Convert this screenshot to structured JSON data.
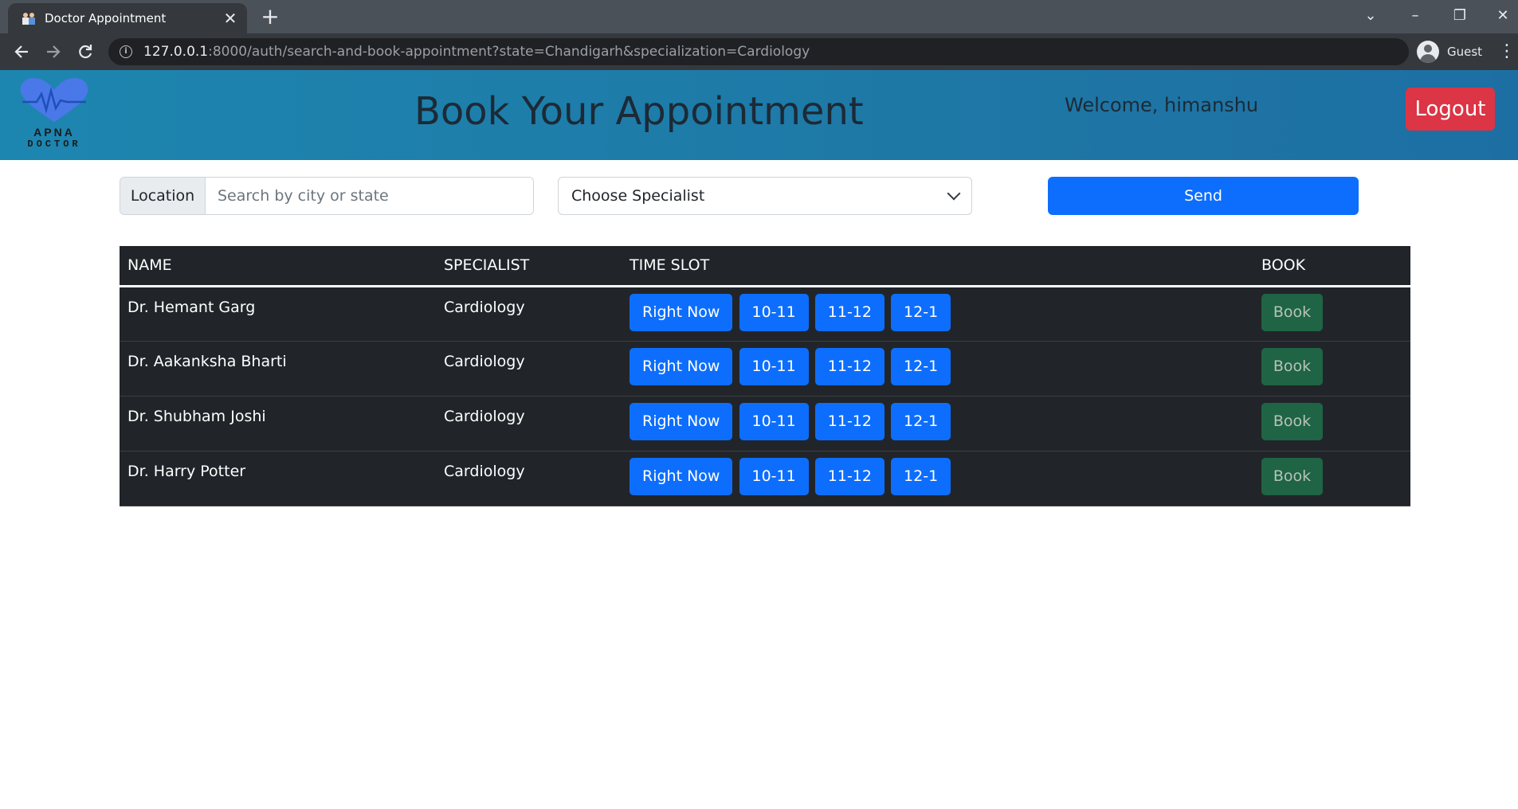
{
  "browser": {
    "tab_title": "Doctor Appointment",
    "tab_close": "✕",
    "new_tab": "+",
    "url_host": "127.0.0.1",
    "url_rest": ":8000/auth/search-and-book-appointment?state=Chandigarh&specialization=Cardiology",
    "profile_label": "Guest",
    "icons": [
      "back-arrow-icon",
      "forward-arrow-icon",
      "reload-icon",
      "info-icon",
      "avatar-icon",
      "menu-dots-icon"
    ]
  },
  "header": {
    "logo_line1": "APNA",
    "logo_line2": "DOCTOR",
    "title": "Book Your Appointment",
    "welcome": "Welcome, himanshu",
    "logout_label": "Logout",
    "colors": {
      "header_bg": "#1e7dac",
      "logout": "#dc3545",
      "heart": "#4a78e8"
    }
  },
  "search": {
    "location_label": "Location",
    "location_placeholder": "Search by city or state",
    "specialist_value": "Choose Specialist",
    "send_label": "Send"
  },
  "table": {
    "headers": [
      "NAME",
      "SPECIALIST",
      "TIME SLOT",
      "BOOK"
    ],
    "rows": [
      {
        "name": "Dr. Hemant Garg",
        "specialist": "Cardiology",
        "slots": [
          "Right Now",
          "10-11",
          "11-12",
          "12-1"
        ],
        "book": "Book"
      },
      {
        "name": "Dr. Aakanksha Bharti",
        "specialist": "Cardiology",
        "slots": [
          "Right Now",
          "10-11",
          "11-12",
          "12-1"
        ],
        "book": "Book"
      },
      {
        "name": "Dr. Shubham Joshi",
        "specialist": "Cardiology",
        "slots": [
          "Right Now",
          "10-11",
          "11-12",
          "12-1"
        ],
        "book": "Book"
      },
      {
        "name": "Dr. Harry Potter",
        "specialist": "Cardiology",
        "slots": [
          "Right Now",
          "10-11",
          "11-12",
          "12-1"
        ],
        "book": "Book"
      }
    ],
    "colors": {
      "table_bg": "#212529",
      "slot": "#0d6efd",
      "book": "#198754"
    }
  }
}
